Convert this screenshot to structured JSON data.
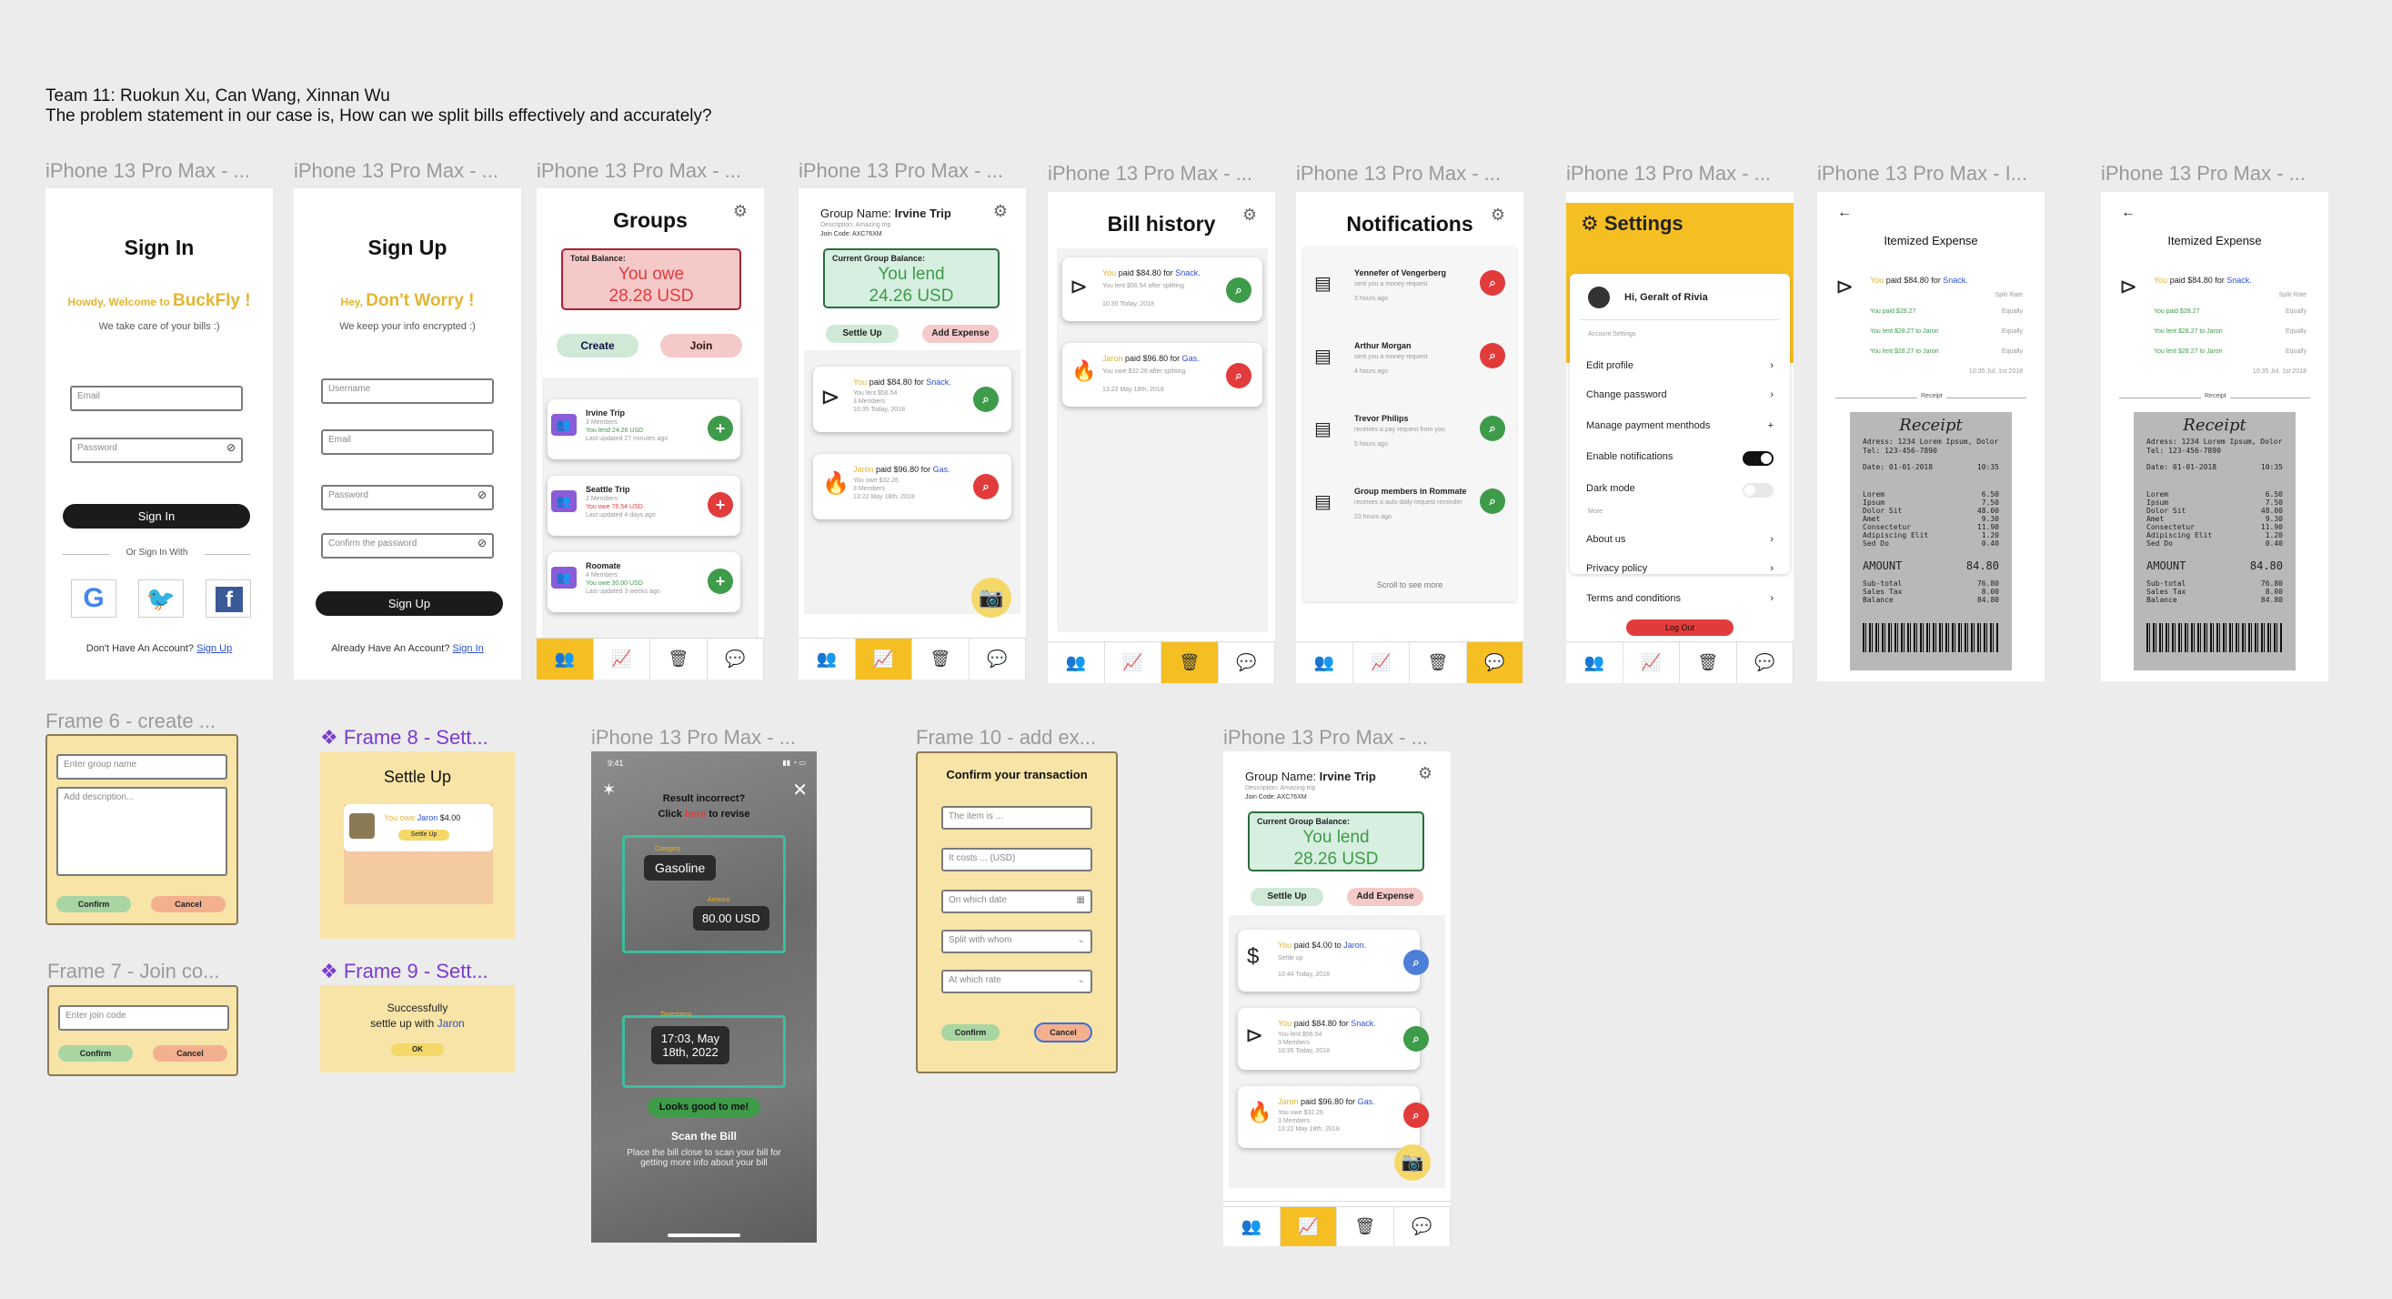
{
  "header": {
    "team": "Team 11: Ruokun Xu, Can Wang, Xinnan Wu",
    "problem": "The problem statement in our case is, How can we split bills effectively and accurately?"
  },
  "labels": {
    "f1": "iPhone 13 Pro Max - ...",
    "f2": "iPhone 13 Pro Max - ...",
    "f3": "iPhone 13 Pro Max - ...",
    "f4": "iPhone 13 Pro Max - ...",
    "f5": "iPhone 13 Pro Max - ...",
    "f6": "iPhone 13 Pro Max - ...",
    "f7": "iPhone 13 Pro Max - ...",
    "f8": "iPhone 13 Pro Max - I...",
    "f9": "iPhone 13 Pro Max - ...",
    "frame6": "Frame 6 - create ...",
    "frame7": "Frame 7 - Join co...",
    "frame8": "Frame 8 - Sett...",
    "frame9": "Frame 9 - Sett...",
    "scan": "iPhone 13 Pro Max - ...",
    "frame10": "Frame 10 - add ex...",
    "trip2": "iPhone 13 Pro Max - ..."
  },
  "signin": {
    "title": "Sign In",
    "howdy": "Howdy, Welcome to",
    "brand": "BuckFly !",
    "sub": "We take care of your bills :)",
    "email_ph": "Email",
    "password_ph": "Password",
    "button": "Sign In",
    "or": "Or Sign In With",
    "footer": "Don't Have An Account?",
    "footer_link": "Sign Up"
  },
  "signup": {
    "title": "Sign Up",
    "hey": "Hey,",
    "dont": "Don't Worry !",
    "sub": "We keep your info encrypted :)",
    "username_ph": "Username",
    "email_ph": "Email",
    "password_ph": "Password",
    "confirm_ph": "Confirm the password",
    "button": "Sign Up",
    "footer": "Already Have An Account?",
    "footer_link": "Sign In"
  },
  "groups": {
    "title": "Groups",
    "balance_label": "Total Balance:",
    "owe": "You owe",
    "amount": "28.28 USD",
    "create": "Create",
    "join": "Join",
    "items": [
      {
        "name": "Irvine Trip",
        "m": "3 Members",
        "d": "You lend 24.26 USD",
        "u": "Last updated 27 minutes ago"
      },
      {
        "name": "Seattle Trip",
        "m": "2 Members",
        "d": "You owe 78.54 USD",
        "u": "Last updated 4 days ago"
      },
      {
        "name": "Roomate",
        "m": "4 Members",
        "d": "You owe 30.00 USD",
        "u": "Last updated 3 weeks ago"
      }
    ]
  },
  "trip": {
    "group_label": "Group Name:",
    "group_name": "Irvine Trip",
    "desc": "Description: Amazing trip",
    "code": "Join Code: AXC76XM",
    "balance_label": "Current Group Balance:",
    "lend": "You lend",
    "amount": "24.26 USD",
    "settle": "Settle Up",
    "add": "Add Expense",
    "e1_who": "You",
    "e1_text": "paid $84.80 for",
    "e1_for": "Snack.",
    "e1_sub1": "You lent $56.54",
    "e1_sub2": "3 Members",
    "e1_sub3": "10:35 Today, 2018",
    "e2_who": "Jaron",
    "e2_text": "paid $96.80 for",
    "e2_for": "Gas.",
    "e2_sub1": "You owe $32.26",
    "e2_sub2": "3 Members",
    "e2_sub3": "13:22 May 18th, 2018"
  },
  "bills": {
    "title": "Bill history",
    "b1_who": "You",
    "b1_text": "paid $84.80 for",
    "b1_for": "Snack.",
    "b1_sub": "You lent $56.54 after splitting",
    "b1_time": "10:35 Today, 2018",
    "b2_who": "Jaron",
    "b2_text": "paid $96.80 for",
    "b2_for": "Gas.",
    "b2_sub": "You owe $32.26 after splitting",
    "b2_time": "13:22 May 18th, 2018"
  },
  "notifications": {
    "title": "Notifications",
    "items": [
      {
        "t": "Yennefer of Vengerberg",
        "s": "sent you a money request",
        "time": "3 hours ago"
      },
      {
        "t": "Arthur Morgan",
        "s": "sent you a money request",
        "time": "4 hours ago"
      },
      {
        "t": "Trevor Philips",
        "s": "receives a pay request from you",
        "time": "5 hours ago"
      },
      {
        "t": "Group members in Rommate",
        "s": "receives a auto daily request reminder",
        "time": "23 hours ago"
      }
    ],
    "scroll": "Scroll to see more"
  },
  "settings": {
    "title": "Settings",
    "greeting": "Hi,",
    "name": "Geralt of Rivia",
    "account": "Account Settings",
    "edit": "Edit profile",
    "change": "Change password",
    "payment": "Manage payment menthods",
    "notif": "Enable notifications",
    "dark": "Dark mode",
    "more": "More",
    "about": "About us",
    "privacy": "Privacy policy",
    "terms": "Terms and conditions",
    "logout": "Log Out"
  },
  "itemized": {
    "title": "Itemized Expense",
    "who": "You",
    "text": "paid $84.80 for",
    "for": "Snack.",
    "split": "Split Rate",
    "rows": [
      "You paid $28.27",
      "You lent $28.27 to Jaron",
      "You lent $28.27 to Jaron"
    ],
    "rate": "Equally",
    "date": "10:35 Jul. 1st 2018",
    "receipt_label": "Receipt",
    "receipt_title": "Receipt",
    "addr": "Adress: 1234 Lorem Ipsum, Dolor",
    "tel": "Tel: 123-456-7890",
    "rdate": "Date: 01-01-2018",
    "rtime": "10:35",
    "lines": [
      [
        "Lorem",
        "6.50"
      ],
      [
        "Ipsum",
        "7.50"
      ],
      [
        "Dolor Sit",
        "48.00"
      ],
      [
        "Amet",
        "9.30"
      ],
      [
        "Consectetur",
        "11.90"
      ],
      [
        "Adipiscing Elit",
        "1.20"
      ],
      [
        "Sed Do",
        "0.40"
      ]
    ],
    "amount_label": "AMOUNT",
    "amount": "84.80",
    "sub": [
      [
        "Sub-total",
        "76.80"
      ],
      [
        "Sales Tax",
        "8.00"
      ],
      [
        "Balance",
        "84.80"
      ]
    ]
  },
  "frame6": {
    "name_ph": "Enter group name",
    "desc_ph": "Add description...",
    "confirm": "Confirm",
    "cancel": "Cancel"
  },
  "frame7": {
    "code_ph": "Enter join code",
    "confirm": "Confirm",
    "cancel": "Cancel"
  },
  "frame8": {
    "title": "Settle Up",
    "owe": "You owe",
    "who": "Jaron",
    "amt": "$4.00",
    "btn": "Settle Up"
  },
  "frame9": {
    "l1": "Successfully",
    "l2": "settle up with",
    "who": "Jaron",
    "ok": "OK"
  },
  "scan": {
    "time": "9:41",
    "q1": "Result incorrect?",
    "q2a": "Click",
    "q2b": "here",
    "q2c": "to revise",
    "cat_label": "Category",
    "cat": "Gasoline",
    "amt_label": "Amount",
    "amt": "80.00 USD",
    "ts_label": "Timestamp",
    "ts": "17:03, May 18th, 2022",
    "good": "Looks good to me!",
    "scan_title": "Scan the Bill",
    "scan_sub": "Place the bill close to scan your bill for getting more info about your bill"
  },
  "frame10": {
    "title": "Confirm your transaction",
    "f1": "The item is ...",
    "f2": "It costs ... (USD)",
    "f3": "On which date",
    "f4": "Split with whom",
    "f5": "At which rate",
    "confirm": "Confirm",
    "cancel": "Cancel"
  },
  "trip2": {
    "amount": "28.26 USD",
    "e0_who": "You",
    "e0_text": "paid $4.00 to",
    "e0_for": "Jaron.",
    "e0_sub1": "Settle up",
    "e0_sub2": "10:44 Today, 2018"
  },
  "colors": {
    "yellow": "#f5bf23",
    "green": "#3e9b49",
    "red": "#e23b3b",
    "pink_bg": "#f6c9c9",
    "mint_bg": "#d6efe0",
    "purple": "#7a3cd0"
  }
}
